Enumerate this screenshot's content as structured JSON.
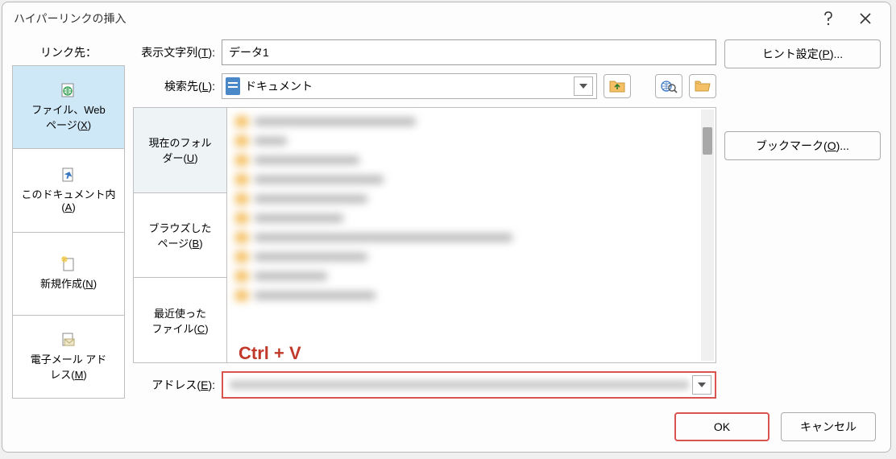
{
  "title": "ハイパーリンクの挿入",
  "linkto": {
    "label": "リンク先：",
    "items": [
      {
        "label_l1": "ファイル、Web",
        "label_l2": "ページ(X)"
      },
      {
        "label_l1": "このドキュメント内",
        "label_l2": "(A)"
      },
      {
        "label_l1": "新規作成(N)",
        "label_l2": ""
      },
      {
        "label_l1": "電子メール アド",
        "label_l2": "レス(M)"
      }
    ]
  },
  "display": {
    "label": "表示文字列(T):",
    "value": "データ1"
  },
  "lookin": {
    "label": "検索先(L):",
    "value": "ドキュメント"
  },
  "subcats": [
    {
      "l1": "現在のフォル",
      "l2": "ダー(U)"
    },
    {
      "l1": "ブラウズした",
      "l2": "ページ(B)"
    },
    {
      "l1": "最近使った",
      "l2": "ファイル(C)"
    }
  ],
  "annotation": "Ctrl + V",
  "address": {
    "label": "アドレス(E):"
  },
  "right": {
    "screen_tip": "ヒント設定(P)...",
    "bookmark": "ブックマーク(O)..."
  },
  "bottom": {
    "ok": "OK",
    "cancel": "キャンセル"
  }
}
